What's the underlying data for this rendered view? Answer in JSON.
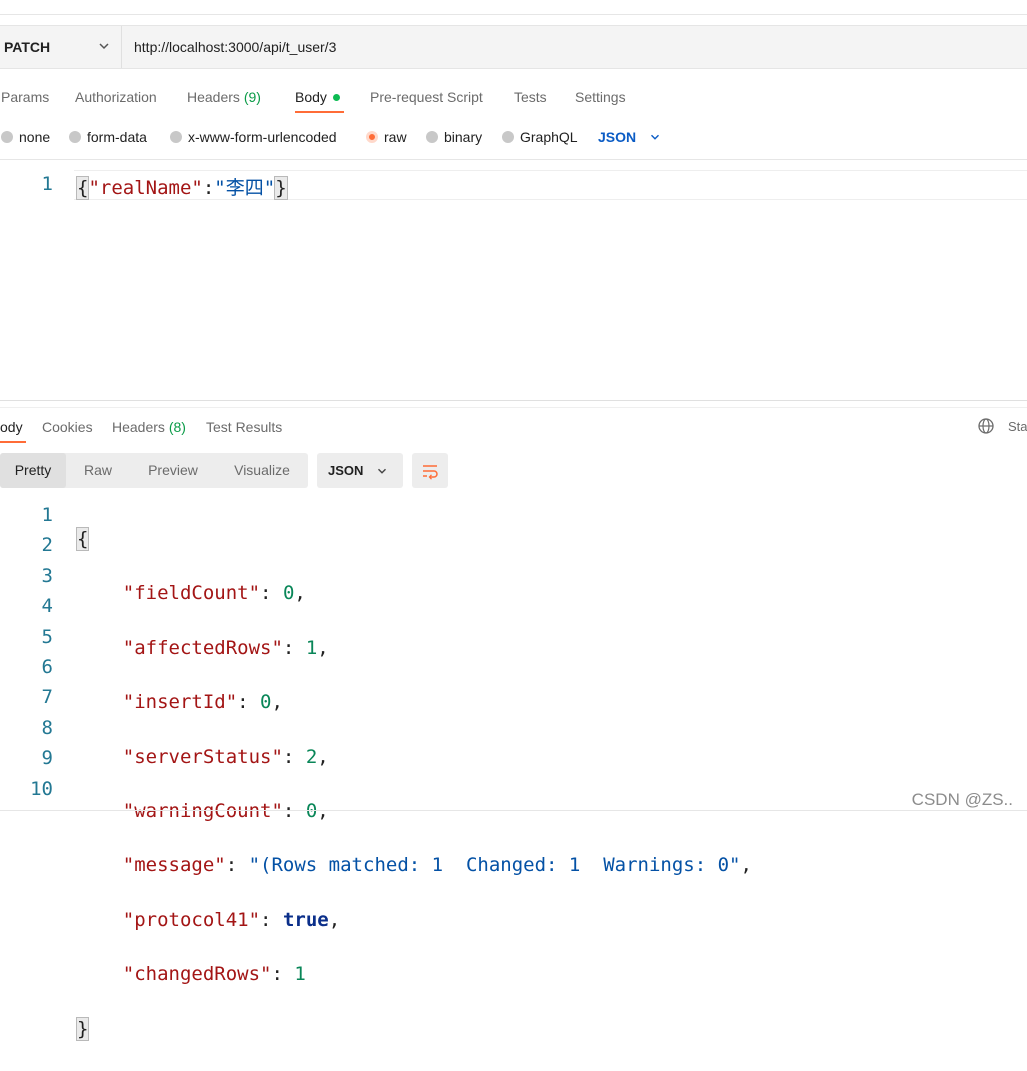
{
  "request": {
    "method": "PATCH",
    "url": "http://localhost:3000/api/t_user/3"
  },
  "request_tabs": [
    {
      "label": "Params"
    },
    {
      "label": "Authorization"
    },
    {
      "label": "Headers",
      "count": "(9)"
    },
    {
      "label": "Body"
    },
    {
      "label": "Pre-request Script"
    },
    {
      "label": "Tests"
    },
    {
      "label": "Settings"
    }
  ],
  "body_types": [
    "none",
    "form-data",
    "x-www-form-urlencoded",
    "raw",
    "binary",
    "GraphQL"
  ],
  "body_language": "JSON",
  "request_body": {
    "line_numbers": [
      "1"
    ],
    "open": "{",
    "key": "\"realName\"",
    "colon": ":",
    "value": "\"李四\"",
    "close": "}"
  },
  "response_tabs": [
    {
      "label": "ody"
    },
    {
      "label": "Cookies"
    },
    {
      "label": "Headers",
      "count": "(8)"
    },
    {
      "label": "Test Results"
    }
  ],
  "status_cut": "Sta",
  "view_modes": [
    "Pretty",
    "Raw",
    "Preview",
    "Visualize"
  ],
  "response_format": "JSON",
  "response_body": {
    "line_numbers": [
      "1",
      "2",
      "3",
      "4",
      "5",
      "6",
      "7",
      "8",
      "9",
      "10"
    ],
    "open": "{",
    "close": "}",
    "fields": [
      {
        "key": "\"fieldCount\"",
        "value": "0",
        "sep": ","
      },
      {
        "key": "\"affectedRows\"",
        "value": "1",
        "sep": ","
      },
      {
        "key": "\"insertId\"",
        "value": "0",
        "sep": ","
      },
      {
        "key": "\"serverStatus\"",
        "value": "2",
        "sep": ","
      },
      {
        "key": "\"warningCount\"",
        "value": "0",
        "sep": ","
      },
      {
        "key": "\"message\"",
        "value": "\"(Rows matched: 1  Changed: 1  Warnings: 0\"",
        "sep": ","
      },
      {
        "key": "\"protocol41\"",
        "value": "true",
        "sep": ","
      },
      {
        "key": "\"changedRows\"",
        "value": "1",
        "sep": ""
      }
    ]
  },
  "watermark": "CSDN @ZS.."
}
